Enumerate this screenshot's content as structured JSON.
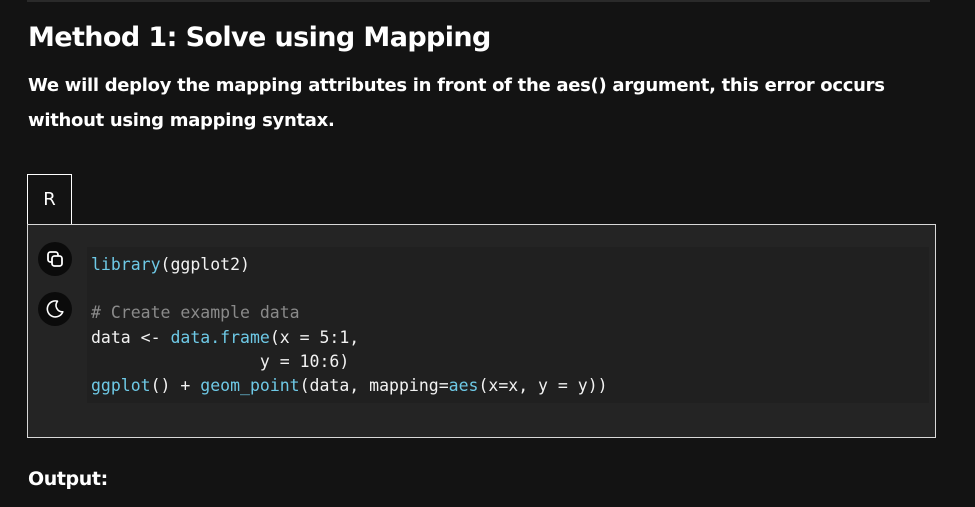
{
  "heading": "Method 1: Solve using Mapping",
  "paragraph": "We will deploy the mapping attributes in front of the aes() argument, this error occurs without using mapping syntax.",
  "code_block": {
    "language_tab": "R",
    "lines": {
      "l1_fn": "library",
      "l1_rest": "(ggplot2)",
      "l3_comment": "# Create example data",
      "l4_var": "data <- ",
      "l4_fn": "data.frame",
      "l4_rest": "(x = 5:1,",
      "l5_rest": "                 y = 10:6)",
      "l6_fn1": "ggplot",
      "l6_mid1": "() + ",
      "l6_fn2": "geom_point",
      "l6_mid2": "(data, mapping=",
      "l6_fn3": "aes",
      "l6_rest": "(x=x, y = y))"
    }
  },
  "icons": {
    "copy": "copy-icon",
    "theme": "moon-icon"
  },
  "output_label": "Output:"
}
